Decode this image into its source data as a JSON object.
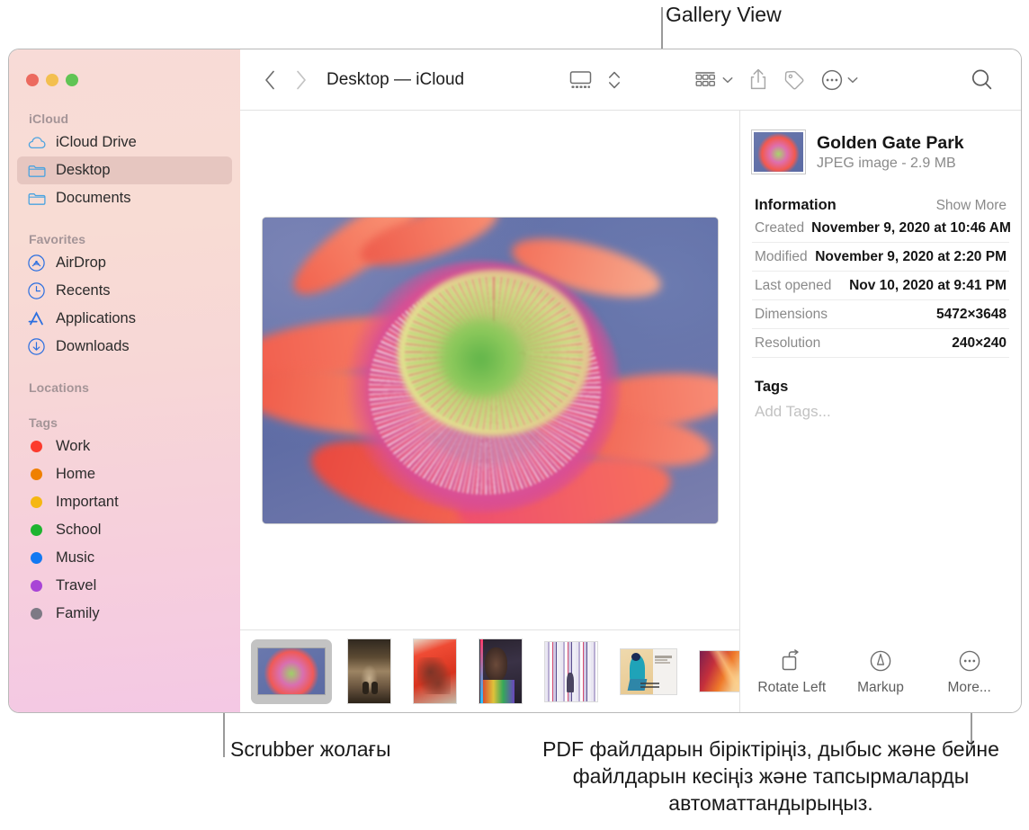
{
  "callouts": {
    "gallery_view": "Gallery View",
    "scrubber": "Scrubber жолағы",
    "more": "PDF файлдарын біріктіріңіз, дыбыс және бейне файлдарын кесіңіз және тапсырмаларды автоматтандырыңыз."
  },
  "window": {
    "title": "Desktop — iCloud"
  },
  "toolbar": {
    "back_icon": "chevron-left-icon",
    "forward_icon": "chevron-right-icon",
    "view_gallery_icon": "gallery-view-icon",
    "view_stepper_icon": "up-down-chevron-icon",
    "group_icon": "group-items-icon",
    "group_chevron": "chevron-down-icon",
    "share_icon": "share-icon",
    "tag_icon": "tag-icon",
    "action_icon": "ellipsis-circle-icon",
    "action_chevron": "chevron-down-icon",
    "search_icon": "search-icon"
  },
  "sidebar": {
    "groups": [
      {
        "title": "iCloud",
        "items": [
          {
            "label": "iCloud Drive",
            "icon": "icloud-icon",
            "color": "#4aa3e0",
            "selected": false
          },
          {
            "label": "Desktop",
            "icon": "folder-icon",
            "color": "#4aa3e0",
            "selected": true
          },
          {
            "label": "Documents",
            "icon": "folder-icon",
            "color": "#4aa3e0",
            "selected": false
          }
        ]
      },
      {
        "title": "Favorites",
        "items": [
          {
            "label": "AirDrop",
            "icon": "airdrop-icon",
            "color": "#2b6fe0",
            "selected": false
          },
          {
            "label": "Recents",
            "icon": "clock-icon",
            "color": "#2b6fe0",
            "selected": false
          },
          {
            "label": "Applications",
            "icon": "applications-icon",
            "color": "#2b6fe0",
            "selected": false
          },
          {
            "label": "Downloads",
            "icon": "downloads-icon",
            "color": "#2b6fe0",
            "selected": false
          }
        ]
      },
      {
        "title": "Locations",
        "items": []
      },
      {
        "title": "Tags",
        "items": [
          {
            "label": "Work",
            "icon": "tag-dot-icon",
            "color": "#fc3b2d"
          },
          {
            "label": "Home",
            "icon": "tag-dot-icon",
            "color": "#ef8000"
          },
          {
            "label": "Important",
            "icon": "tag-dot-icon",
            "color": "#f5b712"
          },
          {
            "label": "School",
            "icon": "tag-dot-icon",
            "color": "#1eb430"
          },
          {
            "label": "Music",
            "icon": "tag-dot-icon",
            "color": "#1379f2"
          },
          {
            "label": "Travel",
            "icon": "tag-dot-icon",
            "color": "#a845d6"
          },
          {
            "label": "Family",
            "icon": "tag-dot-icon",
            "color": "#7d7a85"
          }
        ]
      }
    ]
  },
  "scrubber": {
    "thumbnails": [
      {
        "name": "golden-gate-park-flower",
        "selected": true,
        "w": 74,
        "h": 51
      },
      {
        "name": "forest-path-photo",
        "selected": false,
        "w": 47,
        "h": 71
      },
      {
        "name": "red-hands-artwork",
        "selected": false,
        "w": 47,
        "h": 71
      },
      {
        "name": "portrait-photo",
        "selected": false,
        "w": 47,
        "h": 71
      },
      {
        "name": "stripes-artwork",
        "selected": false,
        "w": 58,
        "h": 66
      },
      {
        "name": "louisa-farris-document",
        "selected": false,
        "w": 62,
        "h": 50
      },
      {
        "name": "gradient-artwork",
        "selected": false,
        "w": 62,
        "h": 45
      },
      {
        "name": "marketing-plan-fall-2019",
        "selected": false,
        "w": 45,
        "h": 66
      }
    ]
  },
  "info": {
    "file_name": "Golden Gate Park",
    "file_meta": "JPEG image - 2.9 MB",
    "section_title": "Information",
    "show_more": "Show More",
    "rows": [
      {
        "label": "Created",
        "value": "November 9, 2020 at 10:46 AM"
      },
      {
        "label": "Modified",
        "value": "November 9, 2020 at 2:20 PM"
      },
      {
        "label": "Last opened",
        "value": "Nov 10, 2020 at 9:41 PM"
      },
      {
        "label": "Dimensions",
        "value": "5472×3648"
      },
      {
        "label": "Resolution",
        "value": "240×240"
      }
    ],
    "tags_title": "Tags",
    "add_tags_placeholder": "Add Tags...",
    "actions": [
      {
        "label": "Rotate Left",
        "icon": "rotate-left-icon"
      },
      {
        "label": "Markup",
        "icon": "markup-icon"
      },
      {
        "label": "More...",
        "icon": "ellipsis-circle-icon"
      }
    ]
  },
  "colors": {
    "sidebar_top": "#f8dbd7",
    "sidebar_bottom": "#f4c8e4",
    "selection": "rgba(160,110,110,0.20)",
    "callout_line": "#9a9a9a"
  }
}
